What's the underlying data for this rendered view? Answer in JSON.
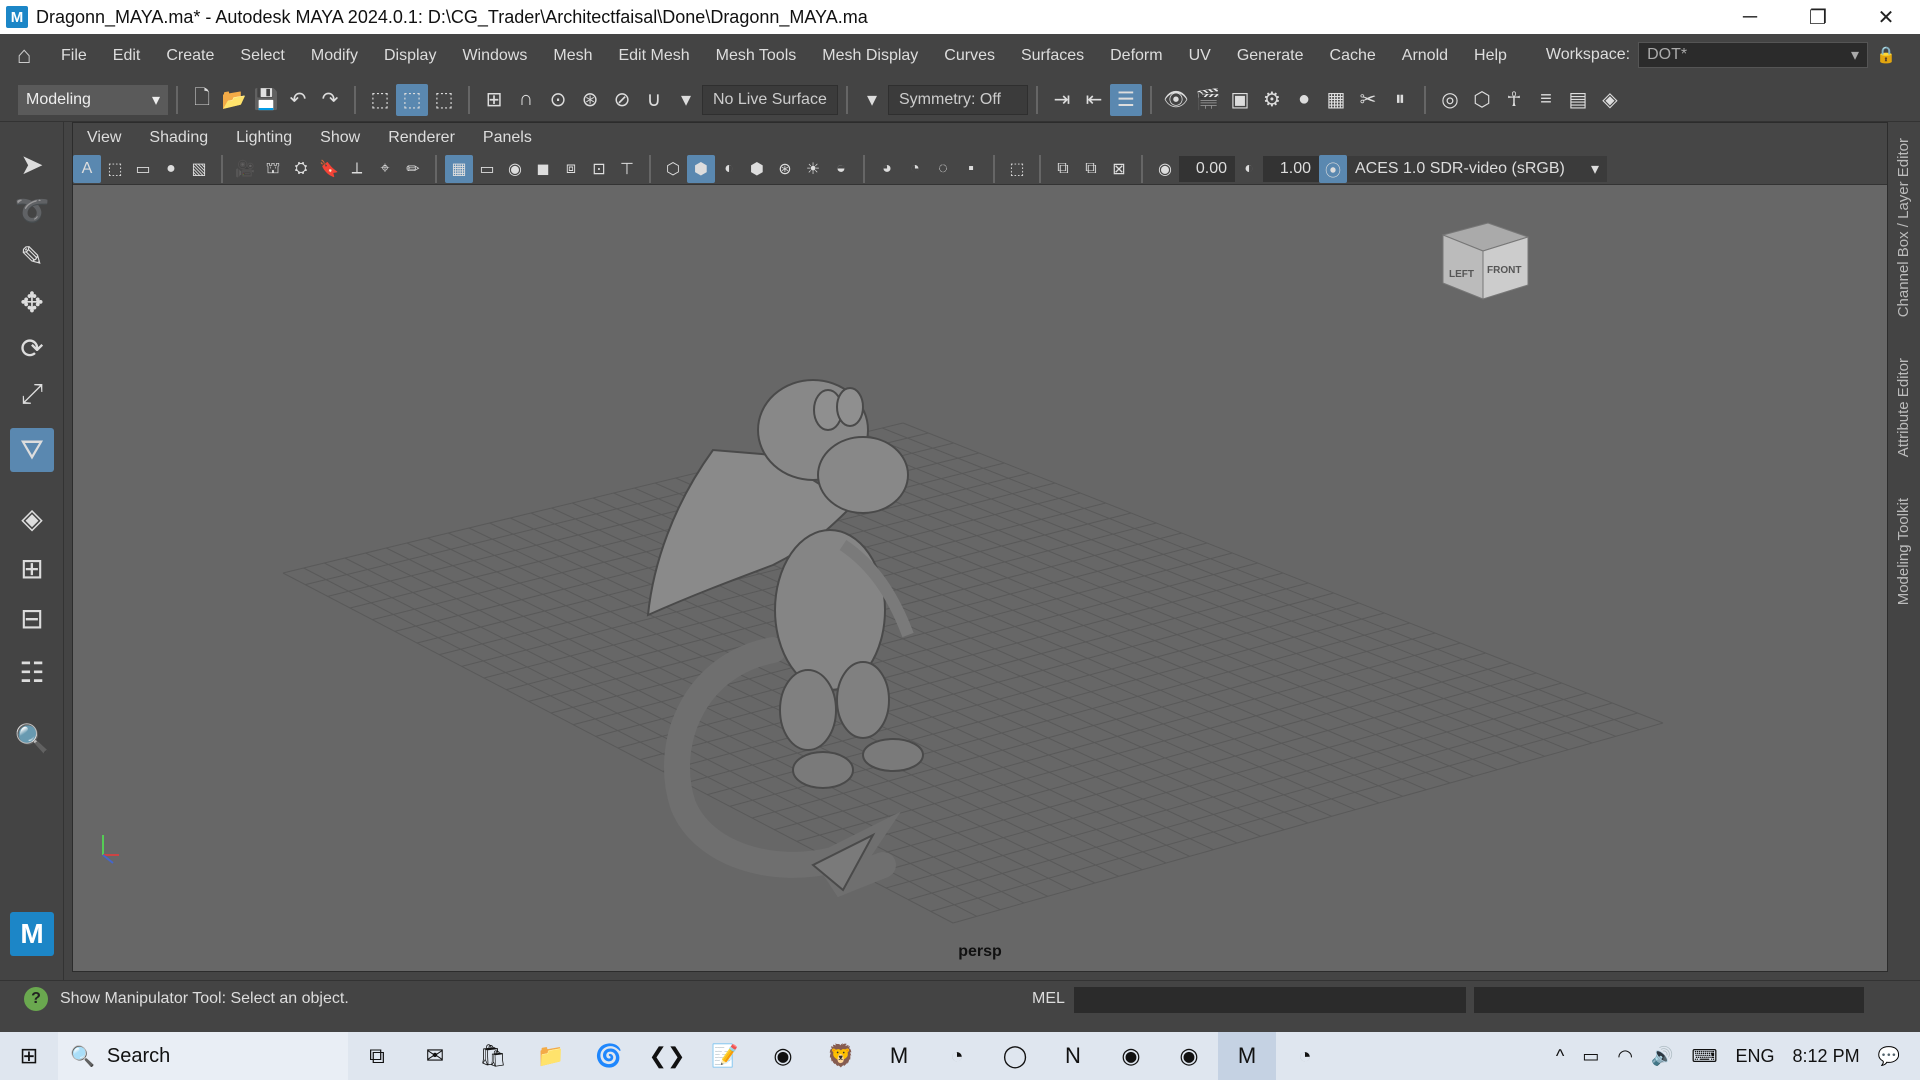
{
  "window": {
    "title": "Dragonn_MAYA.ma* - Autodesk MAYA 2024.0.1: D:\\CG_Trader\\Architectfaisal\\Done\\Dragonn_MAYA.ma",
    "app_icon": "M",
    "controls": [
      "─",
      "❐",
      "✕"
    ]
  },
  "menubar": {
    "items": [
      "File",
      "Edit",
      "Create",
      "Select",
      "Modify",
      "Display",
      "Windows",
      "Mesh",
      "Edit Mesh",
      "Mesh Tools",
      "Mesh Display",
      "Curves",
      "Surfaces",
      "Deform",
      "UV",
      "Generate",
      "Cache",
      "Arnold",
      "Help"
    ],
    "workspace_label": "Workspace:",
    "workspace_value": "DOT*"
  },
  "shelf": {
    "mode": "Modeling",
    "live_surface": "No Live Surface",
    "symmetry": "Symmetry: Off"
  },
  "panel": {
    "menu": [
      "View",
      "Shading",
      "Lighting",
      "Show",
      "Renderer",
      "Panels"
    ],
    "exposure": "0.00",
    "gamma": "1.00",
    "color_management": "ACES 1.0 SDR-video (sRGB)",
    "camera_label": "persp",
    "viewcube_left": "LEFT",
    "viewcube_front": "FRONT"
  },
  "sidetabs": [
    "Channel Box / Layer Editor",
    "Attribute Editor",
    "Modeling Toolkit"
  ],
  "status": {
    "help_text": "Show Manipulator Tool: Select an object.",
    "mel_label": "MEL"
  },
  "taskbar": {
    "search_placeholder": "Search",
    "lang": "ENG",
    "time": "8:12 PM"
  }
}
